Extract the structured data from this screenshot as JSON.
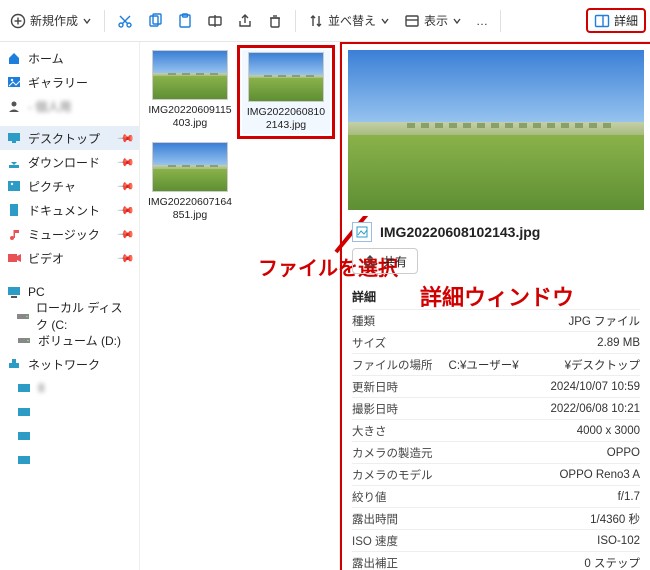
{
  "toolbar": {
    "new_label": "新規作成",
    "sort_label": "並べ替え",
    "view_label": "表示",
    "details_label": "詳細"
  },
  "nav": {
    "items": [
      {
        "label": "ホーム",
        "icon": "home",
        "color": "#1d7edc"
      },
      {
        "label": "ギャラリー",
        "icon": "gallery",
        "color": "#1d7edc"
      },
      {
        "label": "- 個人用",
        "icon": "user",
        "color": "#555",
        "blur": true
      }
    ],
    "quick": [
      {
        "label": "デスクトップ",
        "icon": "desktop",
        "color": "#2c9cc7",
        "pinned": true,
        "selected": true
      },
      {
        "label": "ダウンロード",
        "icon": "download",
        "color": "#2c9cc7",
        "pinned": true
      },
      {
        "label": "ピクチャ",
        "icon": "pictures",
        "color": "#2c9cc7",
        "pinned": true
      },
      {
        "label": "ドキュメント",
        "icon": "documents",
        "color": "#2c9cc7",
        "pinned": true
      },
      {
        "label": "ミュージック",
        "icon": "music",
        "color": "#e85257",
        "pinned": true
      },
      {
        "label": "ビデオ",
        "icon": "video",
        "color": "#e85257",
        "pinned": true
      }
    ],
    "pc_label": "PC",
    "drives": [
      {
        "label": "ローカル ディスク (C:"
      },
      {
        "label": "ボリューム (D:)"
      }
    ],
    "network_label": "ネットワーク",
    "network_items": [
      "8",
      "",
      "",
      ""
    ]
  },
  "files": {
    "items": [
      {
        "name": "IMG20220609115403.jpg",
        "selected": false
      },
      {
        "name": "IMG20220608102143.jpg",
        "selected": true
      },
      {
        "name": "IMG20220607164851.jpg",
        "selected": false
      }
    ]
  },
  "callout_select": "ファイルを選択",
  "callout_pane": "詳細ウィンドウ",
  "details": {
    "filename": "IMG20220608102143.jpg",
    "share_label": "共有",
    "section_label": "詳細",
    "rows": [
      {
        "k": "種類",
        "v": "JPG ファイル"
      },
      {
        "k": "サイズ",
        "v": "2.89 MB"
      },
      {
        "k": "ファイルの場所",
        "v": "C:¥ユーザー¥　　　　¥デスクトップ"
      },
      {
        "k": "更新日時",
        "v": "2024/10/07 10:59"
      },
      {
        "k": "撮影日時",
        "v": "2022/06/08 10:21"
      },
      {
        "k": "大きさ",
        "v": "4000 x 3000"
      },
      {
        "k": "カメラの製造元",
        "v": "OPPO"
      },
      {
        "k": "カメラのモデル",
        "v": "OPPO Reno3 A"
      },
      {
        "k": "絞り値",
        "v": "f/1.7"
      },
      {
        "k": "露出時間",
        "v": "1/4360 秒"
      },
      {
        "k": "ISO 速度",
        "v": "ISO-102"
      },
      {
        "k": "露出補正",
        "v": "0 ステップ"
      }
    ]
  }
}
